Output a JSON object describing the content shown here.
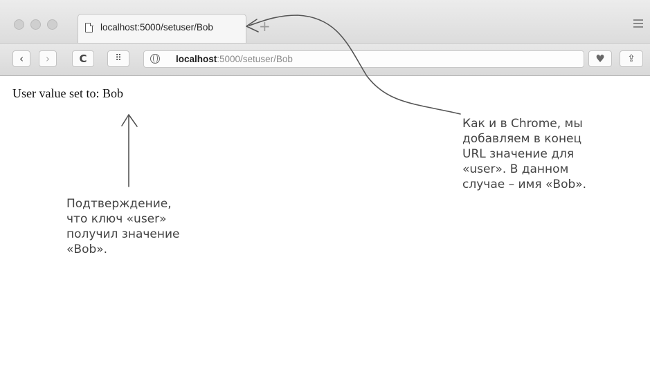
{
  "tab": {
    "title": "localhost:5000/setuser/Bob",
    "new_tab_label": "+"
  },
  "toolbar": {
    "back_label": "‹",
    "forward_label": "›",
    "reload_label": "C",
    "grid_label": "⠿",
    "heart_label": "♥",
    "share_label": "⇪"
  },
  "address": {
    "host": "localhost",
    "path": ":5000/setuser/Bob"
  },
  "page": {
    "text": "User value set to: Bob"
  },
  "annotations": {
    "left": "Подтверждение,\nчто ключ «user»\nполучил значение\n«Bob».",
    "right": "Как и в Chrome, мы\nдобавляем в конец\nURL значение для\n«user». В данном\nслучае – имя «Bob»."
  },
  "colors": {
    "annotation": "#444444",
    "arrow": "#555555"
  }
}
